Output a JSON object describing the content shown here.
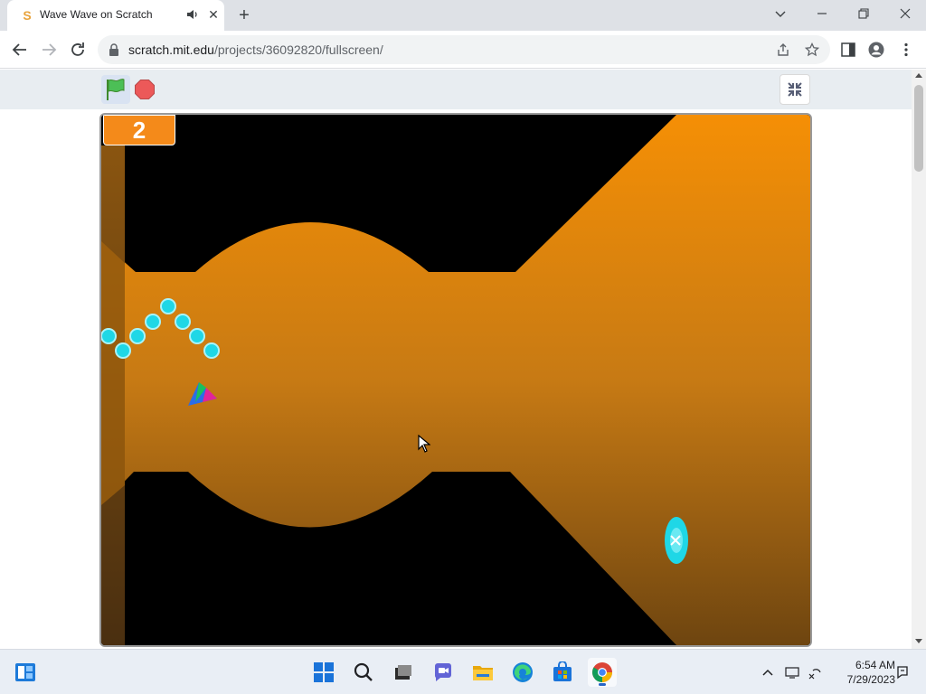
{
  "browser": {
    "tab": {
      "title": "Wave Wave on Scratch",
      "favicon": "scratch-cat-icon",
      "audio_icon": "speaker-icon",
      "close_icon": "close-icon"
    },
    "new_tab_icon": "plus-icon",
    "window_controls": [
      "chevron-down-icon",
      "minimize-icon",
      "restore-icon",
      "close-icon"
    ],
    "address": {
      "host": "scratch.mit.edu",
      "path": "/projects/36092820/fullscreen/"
    },
    "toolbar_icons": [
      "share-icon",
      "star-icon",
      "side-panel-icon",
      "profile-icon",
      "menu-icon"
    ]
  },
  "scratch": {
    "controls": {
      "green_flag": "green-flag-icon",
      "stop": "stop-icon",
      "exit_fullscreen": "exit-fullscreen-icon"
    },
    "score": "2",
    "colors": {
      "orange_top": "#f58f05",
      "orange_bottom": "#6e4510",
      "accent_cyan": "#1fd7e6",
      "background": "#000000"
    }
  },
  "taskbar": {
    "apps": [
      "widgets-icon",
      "windows-start-icon",
      "search-icon",
      "task-view-icon",
      "chat-icon",
      "file-explorer-icon",
      "edge-icon",
      "store-icon",
      "chrome-icon"
    ],
    "tray": [
      "chevron-up-icon",
      "display-icon",
      "network-off-icon",
      "notification-icon"
    ],
    "time": "6:54 AM",
    "date": "7/29/2023"
  }
}
